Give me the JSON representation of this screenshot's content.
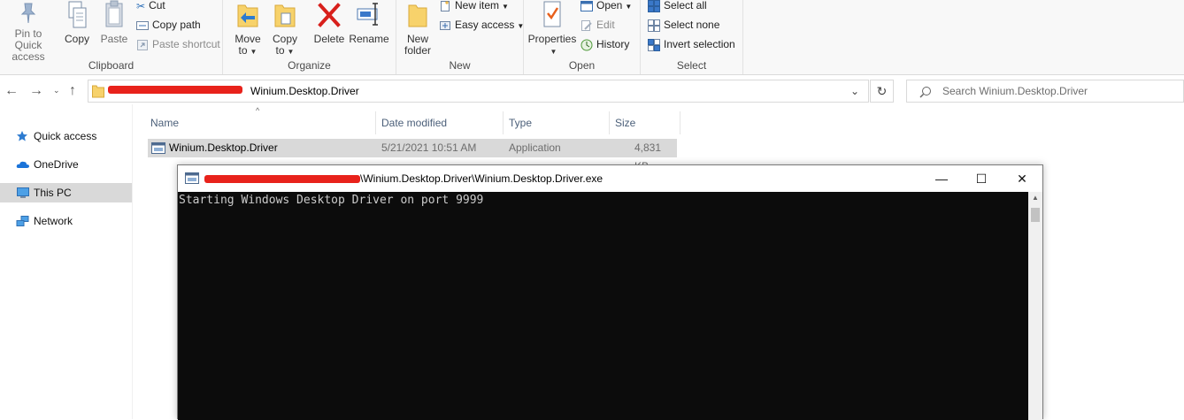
{
  "ribbon": {
    "clipboard": {
      "label": "Clipboard",
      "pin_label": "Pin to Quick",
      "pin_label2": "access",
      "copy": "Copy",
      "paste": "Paste",
      "cut": "Cut",
      "copy_path": "Copy path",
      "paste_shortcut": "Paste shortcut"
    },
    "organize": {
      "label": "Organize",
      "move_to": "Move",
      "move_to2": "to",
      "copy_to": "Copy",
      "copy_to2": "to",
      "delete": "Delete",
      "rename": "Rename"
    },
    "new": {
      "label": "New",
      "new_folder": "New",
      "new_folder2": "folder",
      "new_item": "New item",
      "easy_access": "Easy access"
    },
    "open": {
      "label": "Open",
      "properties": "Properties",
      "open": "Open",
      "edit": "Edit",
      "history": "History"
    },
    "select": {
      "label": "Select",
      "select_all": "Select all",
      "select_none": "Select none",
      "invert": "Invert selection"
    }
  },
  "address": {
    "folder": "Winium.Desktop.Driver",
    "search_placeholder": "Search Winium.Desktop.Driver"
  },
  "nav": {
    "items": [
      {
        "label": "Quick access",
        "icon": "star-icon"
      },
      {
        "label": "OneDrive",
        "icon": "cloud-icon"
      },
      {
        "label": "This PC",
        "icon": "computer-icon"
      },
      {
        "label": "Network",
        "icon": "network-icon"
      }
    ]
  },
  "filelist": {
    "columns": [
      "Name",
      "Date modified",
      "Type",
      "Size"
    ],
    "rows": [
      {
        "name": "Winium.Desktop.Driver",
        "date": "5/21/2021 10:51 AM",
        "type": "Application",
        "size": "4,831 KB"
      }
    ]
  },
  "console": {
    "title": "\\Winium.Desktop.Driver\\Winium.Desktop.Driver.exe",
    "output": "Starting Windows Desktop Driver on port 9999",
    "minimize": "—",
    "maximize": "☐",
    "close": "✕"
  },
  "colors": {
    "accent": "#0078d7",
    "redaction": "#e8221b",
    "terminal_bg": "#0c0c0c",
    "terminal_fg": "#cccccc",
    "selected_row": "#d9d9d9"
  }
}
